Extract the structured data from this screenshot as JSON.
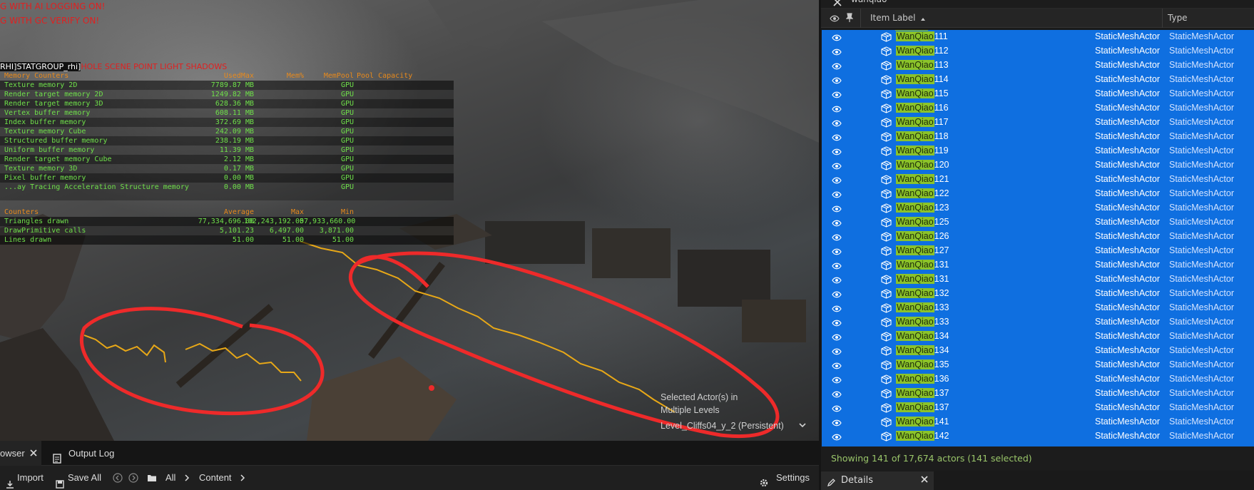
{
  "debug_lines": [
    "G WITH AI LOGGING ON!",
    "G WITH GC VERIFY ON!"
  ],
  "stat_header": {
    "prefix": "RHI]STATGROUP_rhi]",
    "suffix": "HOLE SCENE POINT LIGHT SHADOWS"
  },
  "memory": {
    "headers": [
      "Memory Counters",
      "UsedMax",
      "Mem%",
      "MemPool",
      "Pool Capacity"
    ],
    "rows": [
      [
        "Texture memory 2D",
        "7789.87 MB",
        "",
        "GPU"
      ],
      [
        "Render target memory 2D",
        "1249.82 MB",
        "",
        "GPU"
      ],
      [
        "Render target memory 3D",
        "628.36 MB",
        "",
        "GPU"
      ],
      [
        "Vertex buffer memory",
        "608.11 MB",
        "",
        "GPU"
      ],
      [
        "Index buffer memory",
        "372.69 MB",
        "",
        "GPU"
      ],
      [
        "Texture memory Cube",
        "242.09 MB",
        "",
        "GPU"
      ],
      [
        "Structured buffer memory",
        "238.19 MB",
        "",
        "GPU"
      ],
      [
        "Uniform buffer memory",
        "11.39 MB",
        "",
        "GPU"
      ],
      [
        "Render target memory Cube",
        "2.12 MB",
        "",
        "GPU"
      ],
      [
        "Texture memory 3D",
        "0.17 MB",
        "",
        "GPU"
      ],
      [
        "Pixel buffer memory",
        "0.00 MB",
        "",
        "GPU"
      ],
      [
        "...ay Tracing Acceleration Structure memory",
        "0.00 MB",
        "",
        "GPU"
      ]
    ]
  },
  "counters": {
    "headers": [
      "Counters",
      "Average",
      "Max",
      "Min"
    ],
    "rows": [
      [
        "Triangles drawn",
        "77,334,696.00",
        "102,243,192.00",
        "57,933,660.00"
      ],
      [
        "DrawPrimitive calls",
        "5,101.23",
        "6,497.00",
        "3,871.00"
      ],
      [
        "Lines drawn",
        "51.00",
        "51.00",
        "51.00"
      ]
    ]
  },
  "level_tip": {
    "line1": "Selected Actor(s) in",
    "line2": "Multiple Levels",
    "level": "Level_Cliffs04_y_2 (Persistent)"
  },
  "bottom": {
    "browser_tab": "owser",
    "output_log": "Output Log",
    "import": "Import",
    "save_all": "Save All",
    "all": "All",
    "content": "Content",
    "settings": "Settings"
  },
  "outliner": {
    "search_text": "wanqiao",
    "col_label": "Item Label",
    "col_type": "Type",
    "highlight": "WanQiao",
    "rows": [
      {
        "num": "111",
        "type": "StaticMeshActor"
      },
      {
        "num": "112",
        "type": "StaticMeshActor"
      },
      {
        "num": "113",
        "type": "StaticMeshActor"
      },
      {
        "num": "114",
        "type": "StaticMeshActor"
      },
      {
        "num": "115",
        "type": "StaticMeshActor"
      },
      {
        "num": "116",
        "type": "StaticMeshActor"
      },
      {
        "num": "117",
        "type": "StaticMeshActor"
      },
      {
        "num": "118",
        "type": "StaticMeshActor"
      },
      {
        "num": "119",
        "type": "StaticMeshActor"
      },
      {
        "num": "120",
        "type": "StaticMeshActor"
      },
      {
        "num": "121",
        "type": "StaticMeshActor"
      },
      {
        "num": "122",
        "type": "StaticMeshActor"
      },
      {
        "num": "123",
        "type": "StaticMeshActor"
      },
      {
        "num": "125",
        "type": "StaticMeshActor"
      },
      {
        "num": "126",
        "type": "StaticMeshActor"
      },
      {
        "num": "127",
        "type": "StaticMeshActor"
      },
      {
        "num": "131",
        "type": "StaticMeshActor"
      },
      {
        "num": "131",
        "type": "StaticMeshActor"
      },
      {
        "num": "132",
        "type": "StaticMeshActor"
      },
      {
        "num": "133",
        "type": "StaticMeshActor"
      },
      {
        "num": "133",
        "type": "StaticMeshActor"
      },
      {
        "num": "134",
        "type": "StaticMeshActor"
      },
      {
        "num": "134",
        "type": "StaticMeshActor"
      },
      {
        "num": "135",
        "type": "StaticMeshActor"
      },
      {
        "num": "136",
        "type": "StaticMeshActor"
      },
      {
        "num": "137",
        "type": "StaticMeshActor"
      },
      {
        "num": "137",
        "type": "StaticMeshActor"
      },
      {
        "num": "141",
        "type": "StaticMeshActor"
      },
      {
        "num": "142",
        "type": "StaticMeshActor"
      }
    ],
    "footer": "Showing 141 of 17,674 actors (141 selected)",
    "details_tab": "Details"
  },
  "colors": {
    "selection": "#0f6fe0",
    "highlight": "#8bc32a",
    "annotation": "#ee2a2a",
    "wireframe": "#e8a817"
  }
}
